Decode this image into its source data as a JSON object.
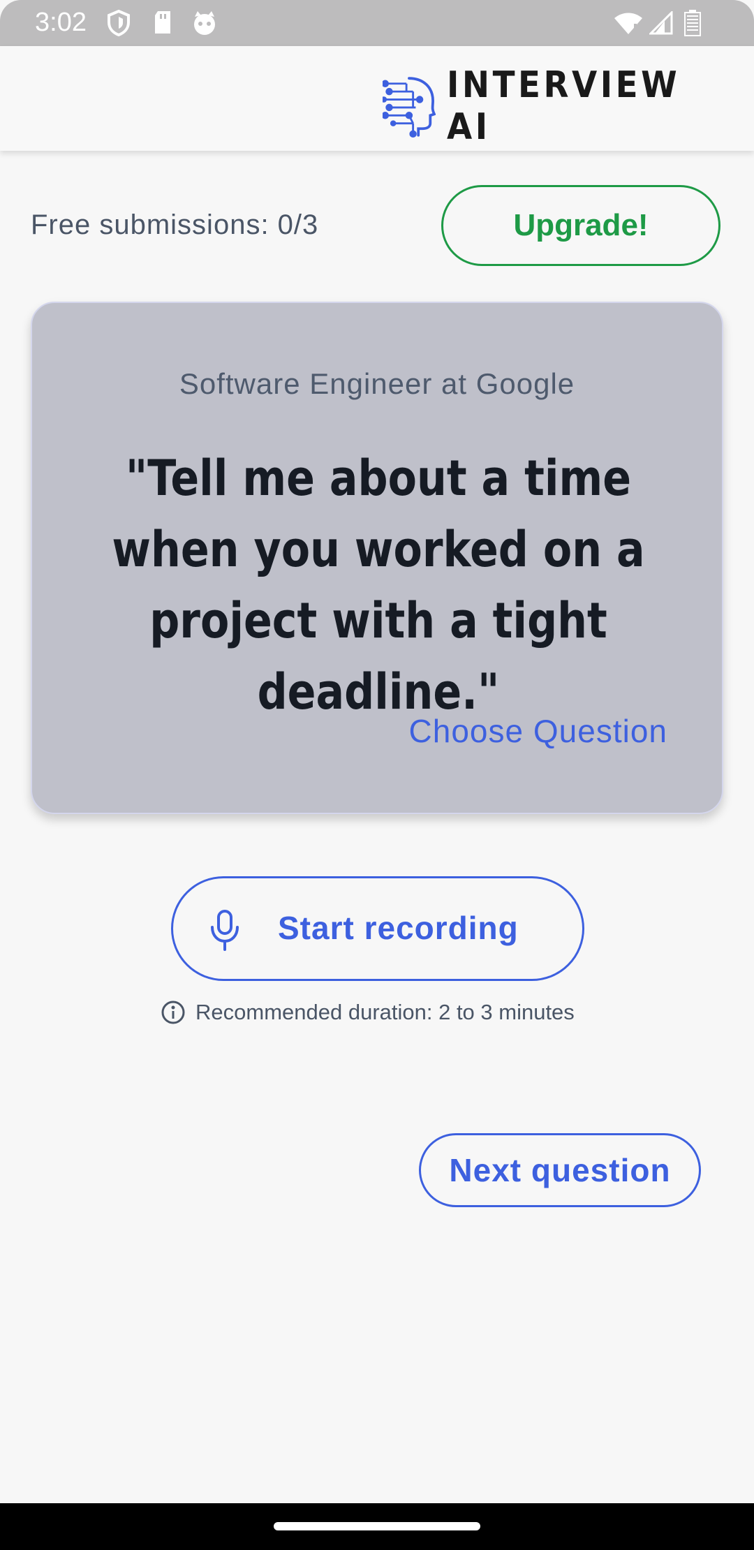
{
  "status_bar": {
    "time": "3:02",
    "icons": [
      "shield-icon",
      "sd-card-icon",
      "cat-face-icon",
      "wifi-icon",
      "signal-icon",
      "battery-icon"
    ]
  },
  "header": {
    "logo_text": "INTERVIEW AI",
    "logo_icon": "ai-head-circuit-icon",
    "accent_color": "#3d60df"
  },
  "submissions": {
    "label": "Free submissions: 0/3",
    "upgrade_label": "Upgrade!",
    "upgrade_color": "#1e9a46"
  },
  "question_card": {
    "company": "Software Engineer at Google",
    "question": "\"Tell me about a time when you worked on a project with a tight deadline.\"",
    "choose_label": "Choose Question"
  },
  "recording": {
    "button_label": "Start recording",
    "mic_icon": "microphone-icon",
    "info_icon": "info-icon",
    "duration_text": "Recommended duration: 2 to 3 minutes"
  },
  "next": {
    "label": "Next question"
  }
}
